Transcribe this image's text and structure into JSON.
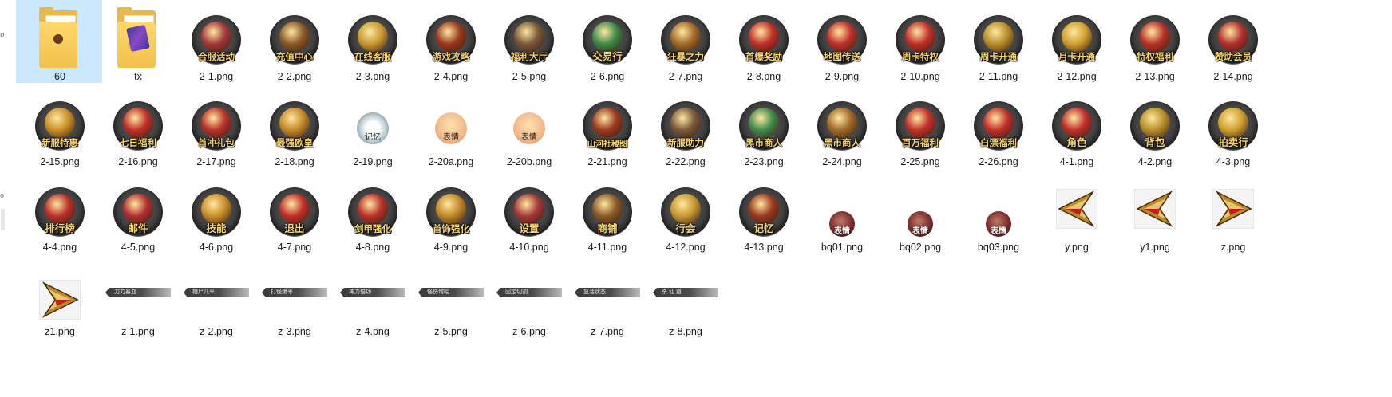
{
  "sidebar": {
    "char_top": "ø",
    "char_mid": "ǝ"
  },
  "files": [
    {
      "name": "60",
      "icon": "folder-icon",
      "label": ""
    },
    {
      "name": "tx",
      "icon": "folder-icon",
      "label": ""
    },
    {
      "name": "2-1.png",
      "icon": "game-round-icon",
      "label": "合服活动"
    },
    {
      "name": "2-2.png",
      "icon": "game-round-icon",
      "label": "充值中心"
    },
    {
      "name": "2-3.png",
      "icon": "game-round-icon",
      "label": "在线客服"
    },
    {
      "name": "2-4.png",
      "icon": "game-round-icon",
      "label": "游戏攻略"
    },
    {
      "name": "2-5.png",
      "icon": "game-round-icon",
      "label": "福利大厅"
    },
    {
      "name": "2-6.png",
      "icon": "game-round-icon",
      "label": "交易行"
    },
    {
      "name": "2-7.png",
      "icon": "game-round-icon",
      "label": "狂暴之力"
    },
    {
      "name": "2-8.png",
      "icon": "game-round-icon",
      "label": "首爆奖励"
    },
    {
      "name": "2-9.png",
      "icon": "game-round-icon",
      "label": "地图传送"
    },
    {
      "name": "2-10.png",
      "icon": "game-round-icon",
      "label": "周卡特权"
    },
    {
      "name": "2-11.png",
      "icon": "game-round-icon",
      "label": "周卡开通"
    },
    {
      "name": "2-12.png",
      "icon": "game-round-icon",
      "label": "月卡开通"
    },
    {
      "name": "2-13.png",
      "icon": "game-round-icon",
      "label": "特权福利"
    },
    {
      "name": "2-14.png",
      "icon": "game-round-icon",
      "label": "赞助会员"
    },
    {
      "name": "2-15.png",
      "icon": "game-round-icon",
      "label": "新服特惠"
    },
    {
      "name": "2-16.png",
      "icon": "game-round-icon",
      "label": "七日福利"
    },
    {
      "name": "2-17.png",
      "icon": "game-round-icon",
      "label": "首冲礼包"
    },
    {
      "name": "2-18.png",
      "icon": "game-round-icon",
      "label": "最强欧皇"
    },
    {
      "name": "2-19.png",
      "icon": "sticker-icon",
      "label": "记忆"
    },
    {
      "name": "2-20a.png",
      "icon": "sticker-icon",
      "label": "表情"
    },
    {
      "name": "2-20b.png",
      "icon": "sticker-icon",
      "label": "表情"
    },
    {
      "name": "2-21.png",
      "icon": "game-round-icon",
      "label": "山河社稷图"
    },
    {
      "name": "2-22.png",
      "icon": "game-round-icon",
      "label": "新服助力"
    },
    {
      "name": "2-23.png",
      "icon": "game-round-icon",
      "label": "黑市商人"
    },
    {
      "name": "2-24.png",
      "icon": "game-round-icon",
      "label": "黑市商人"
    },
    {
      "name": "2-25.png",
      "icon": "game-round-icon",
      "label": "百万福利"
    },
    {
      "name": "2-26.png",
      "icon": "game-round-icon",
      "label": "白漂福利"
    },
    {
      "name": "4-1.png",
      "icon": "game-round-icon",
      "label": "角色"
    },
    {
      "name": "4-2.png",
      "icon": "game-round-icon",
      "label": "背包"
    },
    {
      "name": "4-3.png",
      "icon": "game-round-icon",
      "label": "拍卖行"
    },
    {
      "name": "4-4.png",
      "icon": "game-round-icon",
      "label": "排行榜"
    },
    {
      "name": "4-5.png",
      "icon": "game-round-icon",
      "label": "邮件"
    },
    {
      "name": "4-6.png",
      "icon": "game-round-icon",
      "label": "技能"
    },
    {
      "name": "4-7.png",
      "icon": "game-round-icon",
      "label": "退出"
    },
    {
      "name": "4-8.png",
      "icon": "game-round-icon",
      "label": "剑甲强化"
    },
    {
      "name": "4-9.png",
      "icon": "game-round-icon",
      "label": "首饰强化"
    },
    {
      "name": "4-10.png",
      "icon": "game-round-icon",
      "label": "设置"
    },
    {
      "name": "4-11.png",
      "icon": "game-round-icon",
      "label": "商铺"
    },
    {
      "name": "4-12.png",
      "icon": "game-round-icon",
      "label": "行会"
    },
    {
      "name": "4-13.png",
      "icon": "game-round-icon",
      "label": "记忆"
    },
    {
      "name": "bq01.png",
      "icon": "small-badge-icon",
      "label": "表情"
    },
    {
      "name": "bq02.png",
      "icon": "small-badge-icon",
      "label": "表情"
    },
    {
      "name": "bq03.png",
      "icon": "small-badge-icon",
      "label": "表情"
    },
    {
      "name": "y.png",
      "icon": "arrow-icon",
      "label": ""
    },
    {
      "name": "y1.png",
      "icon": "arrow-icon",
      "label": ""
    },
    {
      "name": "z.png",
      "icon": "arrow-icon",
      "label": ""
    },
    {
      "name": "z1.png",
      "icon": "arrow-icon",
      "label": ""
    },
    {
      "name": "z-1.png",
      "icon": "bar-image-icon",
      "label": "刀刀暴血"
    },
    {
      "name": "z-2.png",
      "icon": "bar-image-icon",
      "label": "鞭尸几率"
    },
    {
      "name": "z-3.png",
      "icon": "bar-image-icon",
      "label": "打怪爆率"
    },
    {
      "name": "z-4.png",
      "icon": "bar-image-icon",
      "label": "神力倍功"
    },
    {
      "name": "z-5.png",
      "icon": "bar-image-icon",
      "label": "怪伤增幅"
    },
    {
      "name": "z-6.png",
      "icon": "bar-image-icon",
      "label": "固定切割"
    },
    {
      "name": "z-7.png",
      "icon": "bar-image-icon",
      "label": "复活状态"
    },
    {
      "name": "z-8.png",
      "icon": "bar-image-icon",
      "label": "杀 仙 道"
    }
  ],
  "selected": "60",
  "colors": {
    "selection": "#cce8ff",
    "folder": "#f1c14c",
    "icon_text": "#f7d36a"
  }
}
